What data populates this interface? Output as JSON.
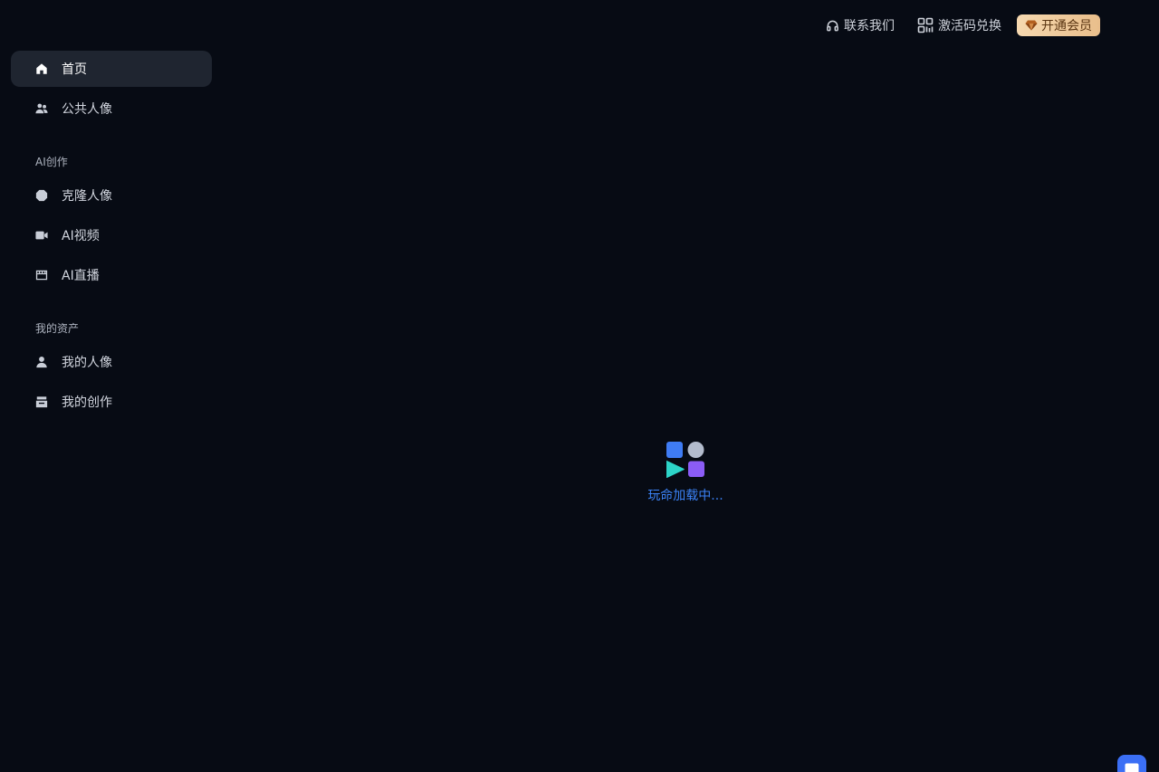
{
  "sidebar": {
    "items_main": [
      {
        "label": "首页",
        "icon": "home-icon",
        "active": true
      },
      {
        "label": "公共人像",
        "icon": "users-icon",
        "active": false
      }
    ],
    "section_ai": "AI创作",
    "items_ai": [
      {
        "label": "克隆人像",
        "icon": "clone-icon"
      },
      {
        "label": "AI视频",
        "icon": "video-camera-icon"
      },
      {
        "label": "AI直播",
        "icon": "live-icon"
      }
    ],
    "section_assets": "我的资产",
    "items_assets": [
      {
        "label": "我的人像",
        "icon": "user-icon"
      },
      {
        "label": "我的创作",
        "icon": "inbox-icon"
      }
    ]
  },
  "topbar": {
    "contact": "联系我们",
    "redeem": "激活码兑换",
    "vip": "开通会员"
  },
  "loader": {
    "text": "玩命加载中..."
  },
  "colors": {
    "background": "#070b14",
    "accent": "#3b82f6",
    "vip_gradient_start": "#f6d9b0",
    "vip_gradient_end": "#e9be8b"
  }
}
